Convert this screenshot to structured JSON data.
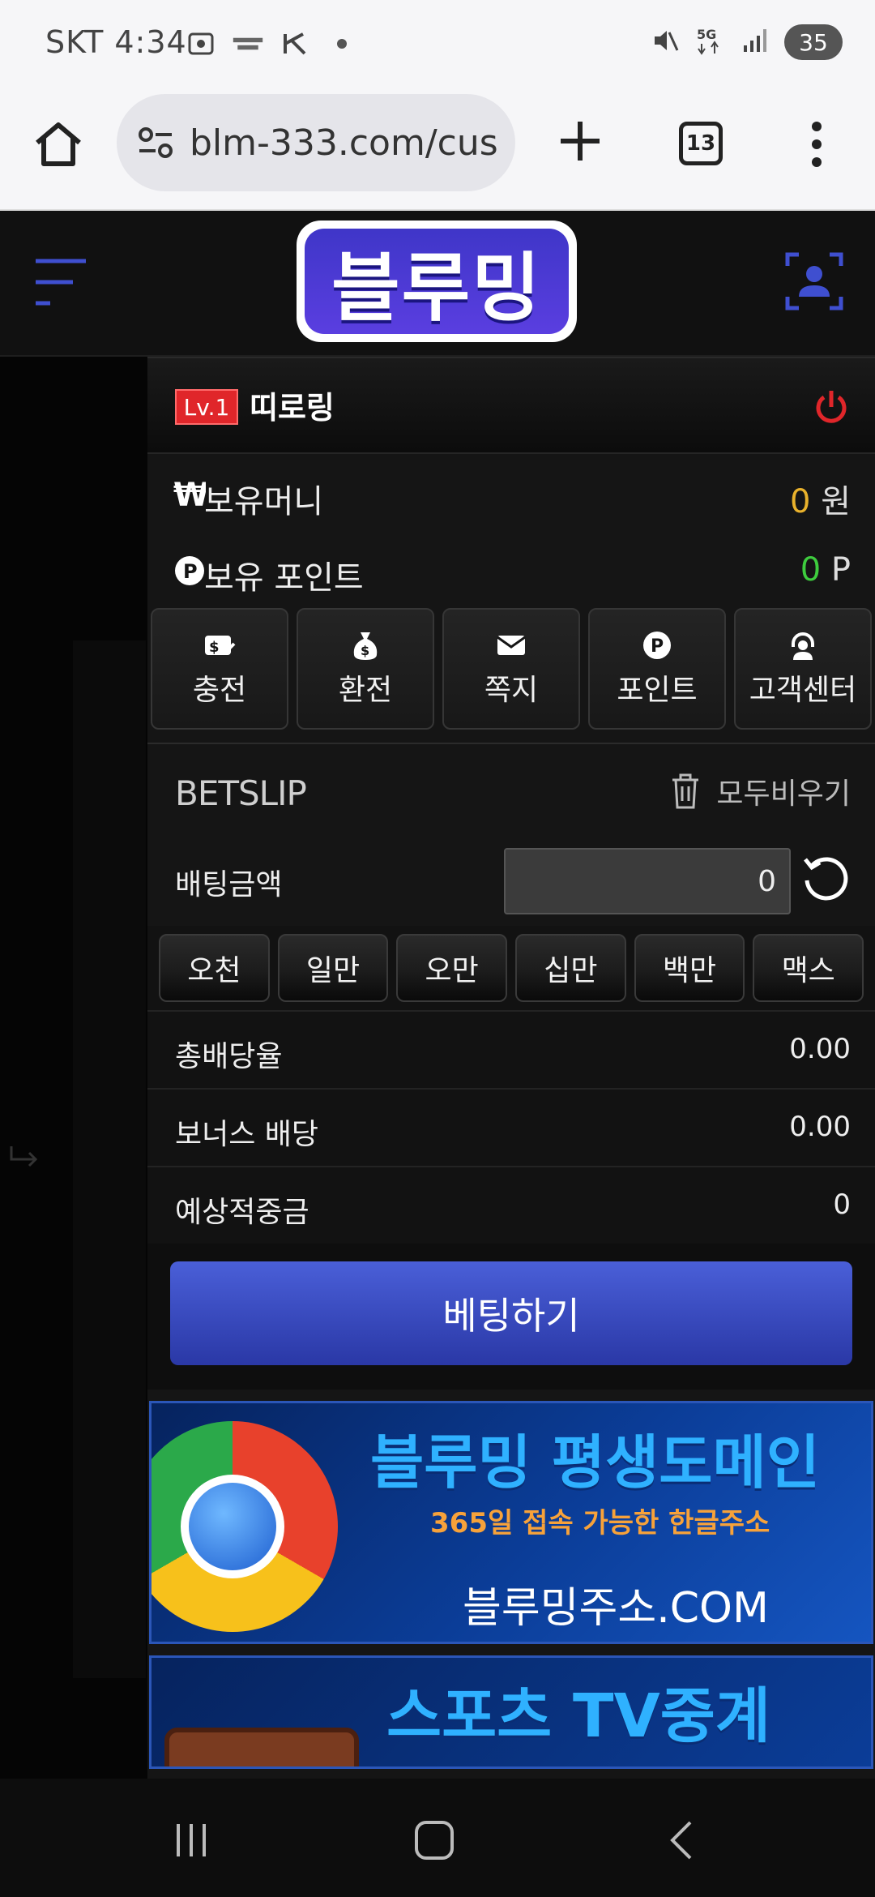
{
  "status_bar": {
    "carrier_time": "SKT 4:34",
    "battery": "35",
    "network": "5G"
  },
  "browser": {
    "url": "blm-333.com/cus",
    "tab_count": "13"
  },
  "site": {
    "logo_text": "블루밍"
  },
  "panel": {
    "level_badge": "Lv.1",
    "username": "띠로링",
    "money_label": "보유머니",
    "money_value": "0",
    "money_unit": "원",
    "point_label": "보유 포인트",
    "point_value": "0",
    "point_unit": "P",
    "quick_buttons": [
      {
        "label": "충전",
        "icon": "deposit-icon"
      },
      {
        "label": "환전",
        "icon": "money-bag-icon"
      },
      {
        "label": "쪽지",
        "icon": "envelope-icon"
      },
      {
        "label": "포인트",
        "icon": "point-icon"
      },
      {
        "label": "고객센터",
        "icon": "support-icon"
      }
    ],
    "betslip_title": "BETSLIP",
    "clear_all": "모두비우기",
    "bet_amount_label": "배팅금액",
    "bet_amount_value": "0",
    "chips": [
      "오천",
      "일만",
      "오만",
      "십만",
      "백만",
      "맥스"
    ],
    "total_odds_label": "총배당율",
    "total_odds_value": "0.00",
    "bonus_odds_label": "보너스 배당",
    "bonus_odds_value": "0.00",
    "expected_win_label": "예상적중금",
    "expected_win_value": "0",
    "bet_button": "베팅하기"
  },
  "banners": {
    "domain_title": "블루밍 평생도메인",
    "domain_sub": "365일 접속 가능한 한글주소",
    "domain_url": "블루밍주소.COM",
    "tv_title": "스포츠 TV중계"
  },
  "colors": {
    "accent_blue": "#3f4fd0",
    "gold": "#e9b22c",
    "green": "#3ecc3e",
    "red": "#e0262a"
  }
}
